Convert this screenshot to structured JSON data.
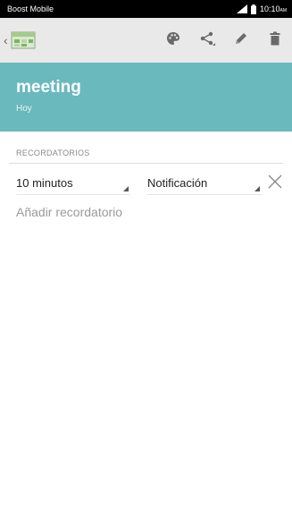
{
  "status_bar": {
    "carrier": "Boost Mobile",
    "time": "10:10",
    "ampm": "AM"
  },
  "toolbar": {
    "icons": [
      "back-chevron-icon",
      "app-icon",
      "palette-icon",
      "share-icon",
      "pencil-icon",
      "trash-icon"
    ]
  },
  "event": {
    "title": "meeting",
    "subtitle": "Hoy",
    "header_color": "#69b9bd"
  },
  "reminders": {
    "section_label": "RECORDATORIOS",
    "items": [
      {
        "time": "10 minutos",
        "type": "Notificación"
      }
    ],
    "add_label": "Añadir recordatorio"
  }
}
